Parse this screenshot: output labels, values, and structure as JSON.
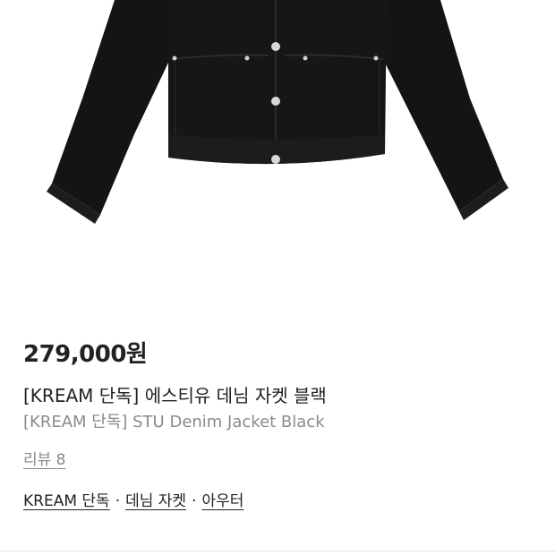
{
  "product": {
    "price": "279,000원",
    "title_ko": "[KREAM 단독] 에스티유 데님 자켓 블랙",
    "title_en": "[KREAM 단독] STU Denim Jacket Black",
    "review_label": "리뷰 8",
    "image_icon": "black-denim-jacket-image"
  },
  "tags": [
    {
      "label": "KREAM 단독"
    },
    {
      "label": "데님 자켓"
    },
    {
      "label": "아우터"
    }
  ],
  "separator": "·"
}
